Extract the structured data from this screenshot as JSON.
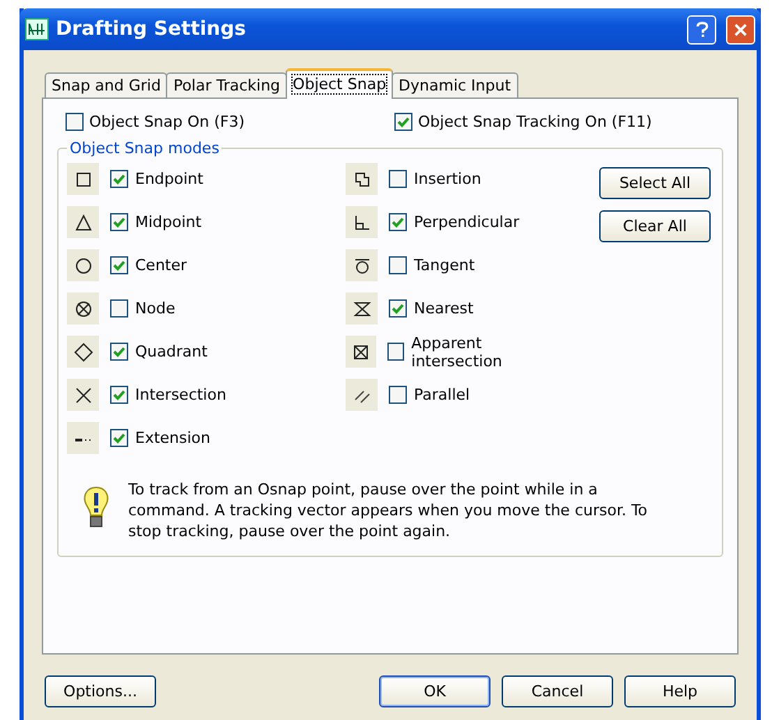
{
  "window": {
    "title": "Drafting Settings"
  },
  "tabs": [
    {
      "label": "Snap and Grid",
      "selected": false
    },
    {
      "label": "Polar Tracking",
      "selected": false
    },
    {
      "label": "Object Snap",
      "selected": true
    },
    {
      "label": "Dynamic Input",
      "selected": false
    }
  ],
  "top_options": [
    {
      "label": "Object Snap On (F3)",
      "checked": false
    },
    {
      "label": "Object Snap Tracking On (F11)",
      "checked": true
    }
  ],
  "group": {
    "title": "Object Snap modes",
    "left_modes": [
      {
        "label": "Endpoint",
        "checked": true
      },
      {
        "label": "Midpoint",
        "checked": true
      },
      {
        "label": "Center",
        "checked": true
      },
      {
        "label": "Node",
        "checked": false
      },
      {
        "label": "Quadrant",
        "checked": true
      },
      {
        "label": "Intersection",
        "checked": true
      },
      {
        "label": "Extension",
        "checked": true
      }
    ],
    "right_modes": [
      {
        "label": "Insertion",
        "checked": false
      },
      {
        "label": "Perpendicular",
        "checked": true
      },
      {
        "label": "Tangent",
        "checked": false
      },
      {
        "label": "Nearest",
        "checked": true
      },
      {
        "label": "Apparent intersection",
        "checked": false
      },
      {
        "label": "Parallel",
        "checked": false
      }
    ],
    "buttons": [
      "Select All",
      "Clear All"
    ],
    "tip": "To track from an Osnap point, pause over the point while in a command.  A tracking vector appears when you move the cursor. To stop tracking, pause over the point again."
  },
  "footer": {
    "left_button": "Options...",
    "buttons": [
      "OK",
      "Cancel",
      "Help"
    ]
  }
}
